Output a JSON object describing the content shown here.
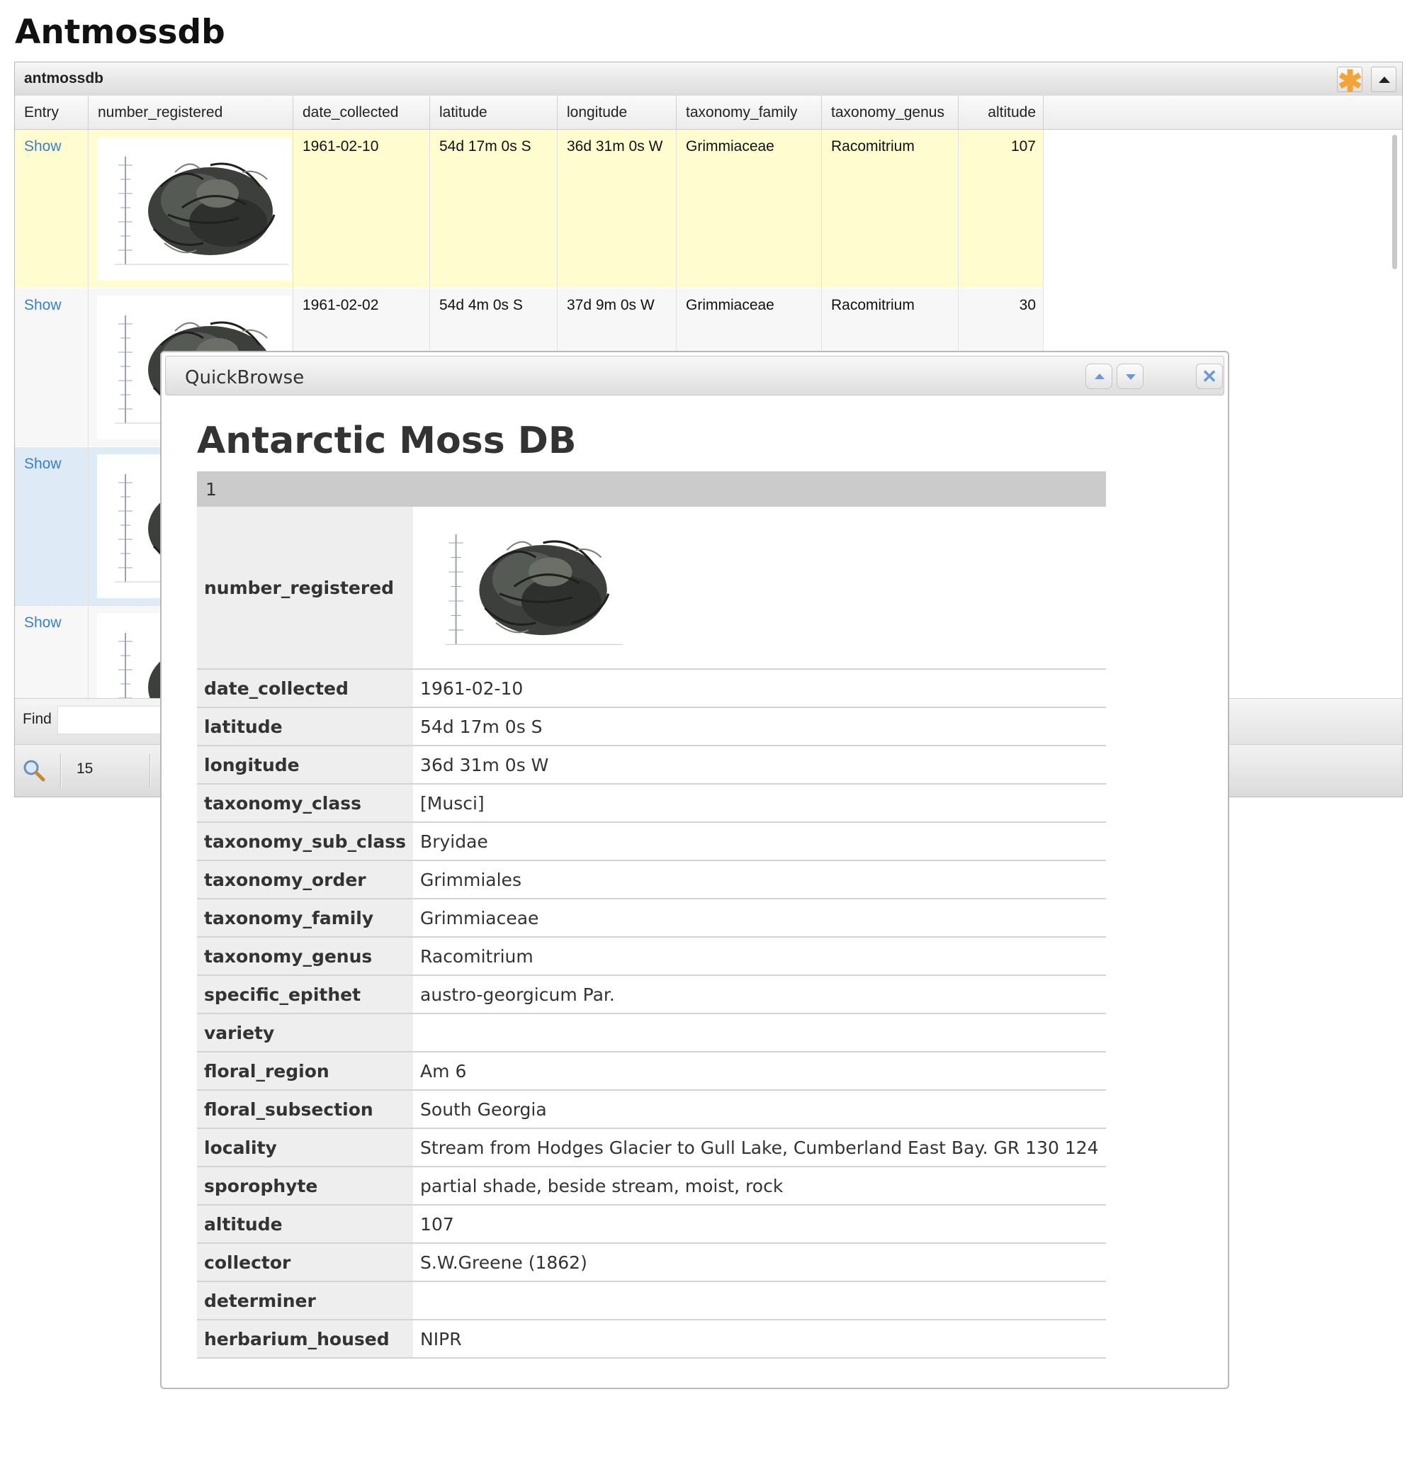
{
  "page": {
    "title": "Antmossdb"
  },
  "grid": {
    "title": "antmossdb",
    "columns": [
      "Entry",
      "number_registered",
      "date_collected",
      "latitude",
      "longitude",
      "taxonomy_family",
      "taxonomy_genus",
      "altitude"
    ],
    "rows": [
      {
        "entry": "Show",
        "date_collected": "1961-02-10",
        "latitude": "54d 17m 0s S",
        "longitude": "36d 31m 0s W",
        "taxonomy_family": "Grimmiaceae",
        "taxonomy_genus": "Racomitrium",
        "altitude": "107"
      },
      {
        "entry": "Show",
        "date_collected": "1961-02-02",
        "latitude": "54d 4m 0s S",
        "longitude": "37d 9m 0s W",
        "taxonomy_family": "Grimmiaceae",
        "taxonomy_genus": "Racomitrium",
        "altitude": "30"
      },
      {
        "entry": "Show"
      },
      {
        "entry": "Show"
      }
    ],
    "find_label": "Find",
    "page_size": "15",
    "icons": {
      "toolbar_tools": "asterisk-icon",
      "toolbar_collapse": "triangle-up-icon",
      "pager_search": "magnifier-icon"
    },
    "colors": {
      "highlight_row": "#fffdd0",
      "selected_row": "#deeaf5",
      "link": "#3a7fc6"
    }
  },
  "quickbrowse": {
    "title": "QuickBrowse",
    "icons": {
      "prev": "chevron-up-icon",
      "next": "chevron-down-icon",
      "close": "close-icon"
    },
    "heading": "Antarctic Moss DB",
    "record_id": "1",
    "fields": [
      {
        "label": "number_registered",
        "value": ""
      },
      {
        "label": "date_collected",
        "value": "1961-02-10"
      },
      {
        "label": "latitude",
        "value": "54d 17m 0s S"
      },
      {
        "label": "longitude",
        "value": "36d 31m 0s W"
      },
      {
        "label": "taxonomy_class",
        "value": "[Musci]"
      },
      {
        "label": "taxonomy_sub_class",
        "value": "Bryidae"
      },
      {
        "label": "taxonomy_order",
        "value": "Grimmiales"
      },
      {
        "label": "taxonomy_family",
        "value": "Grimmiaceae"
      },
      {
        "label": "taxonomy_genus",
        "value": "Racomitrium"
      },
      {
        "label": "specific_epithet",
        "value": "austro-georgicum Par."
      },
      {
        "label": "variety",
        "value": ""
      },
      {
        "label": "floral_region",
        "value": "Am 6"
      },
      {
        "label": "floral_subsection",
        "value": "South Georgia"
      },
      {
        "label": "locality",
        "value": "Stream from Hodges Glacier to Gull Lake, Cumberland East Bay. GR 130 124"
      },
      {
        "label": "sporophyte",
        "value": "partial shade, beside stream, moist, rock"
      },
      {
        "label": "altitude",
        "value": "107"
      },
      {
        "label": "collector",
        "value": "S.W.Greene (1862)"
      },
      {
        "label": "determiner",
        "value": ""
      },
      {
        "label": "herbarium_housed",
        "value": "NIPR"
      }
    ]
  }
}
